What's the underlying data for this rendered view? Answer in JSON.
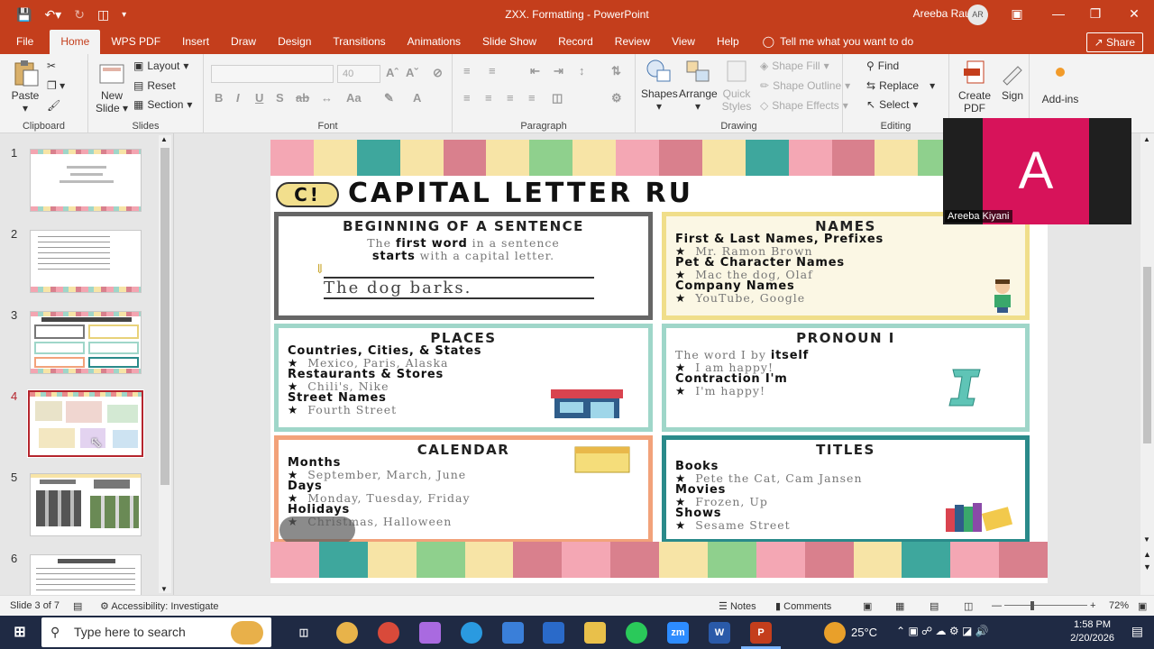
{
  "window": {
    "title": "ZXX. Formatting  -  PowerPoint",
    "user_name": "Areeba Rauf",
    "user_initials": "AR"
  },
  "tabs": [
    "File",
    "Home",
    "WPS PDF",
    "Insert",
    "Draw",
    "Design",
    "Transitions",
    "Animations",
    "Slide Show",
    "Record",
    "Review",
    "View",
    "Help"
  ],
  "tell_me": "Tell me what you want to do",
  "share_label": "Share",
  "ribbon": {
    "clipboard": {
      "label": "Clipboard",
      "paste": "Paste"
    },
    "slides": {
      "label": "Slides",
      "new_slide": "New Slide",
      "layout": "Layout",
      "reset": "Reset",
      "section": "Section"
    },
    "font": {
      "label": "Font",
      "size": "40"
    },
    "paragraph": {
      "label": "Paragraph"
    },
    "drawing": {
      "label": "Drawing",
      "shapes": "Shapes",
      "arrange": "Arrange",
      "quick_styles": "Quick Styles",
      "shape_fill": "Shape Fill",
      "shape_outline": "Shape Outline",
      "shape_effects": "Shape Effects"
    },
    "editing": {
      "label": "Editing",
      "find": "Find",
      "replace": "Replace",
      "select": "Select"
    },
    "pdf": {
      "create_pdf": "Create PDF",
      "sign": "Sign"
    },
    "addins": {
      "label": "Add-ins"
    }
  },
  "slides_panel": [
    "1",
    "2",
    "3",
    "4",
    "5",
    "6"
  ],
  "slide": {
    "heading": "CAPITAL LETTER RU",
    "badge": "C!",
    "cards": {
      "sentence": {
        "title": "BEGINNING OF A SENTENCE",
        "l1a": "The ",
        "l1b": "first word",
        "l1c": " in a sentence",
        "l2a": "starts",
        "l2b": " with a capital letter.",
        "example": "The dog barks."
      },
      "names": {
        "title": "NAMES",
        "h1": "First & Last Names, Prefixes",
        "e1": "Mr. Ramon Brown",
        "h2": "Pet & Character Names",
        "e2": "Mac the dog, Olaf",
        "h3": "Company Names",
        "e3": "YouTube, Google"
      },
      "places": {
        "title": "PLACES",
        "h1": "Countries, Cities, & States",
        "e1": "Mexico, Paris, Alaska",
        "h2": "Restaurants & Stores",
        "e2": "Chili's, Nike",
        "h3": "Street Names",
        "e3": "Fourth Street"
      },
      "pronoun": {
        "title": "PRONOUN I",
        "l1a": "The word I by ",
        "l1b": "itself",
        "e1": "I am happy!",
        "h2": "Contraction I'm",
        "e2": "I'm happy!"
      },
      "calendar": {
        "title": "CALENDAR",
        "h1": "Months",
        "e1": "September, March, June",
        "h2": "Days",
        "e2": "Monday, Tuesday, Friday",
        "h3": "Holidays",
        "e3": "Christmas, Halloween"
      },
      "titles": {
        "title": "TITLES",
        "h1": "Books",
        "e1": "Pete the Cat, Cam Jansen",
        "h2": "Movies",
        "e2": "Frozen, Up",
        "h3": "Shows",
        "e3": "Sesame Street"
      }
    }
  },
  "video": {
    "initial": "A",
    "name": "Areeba Kiyani"
  },
  "status": {
    "slide_count": "Slide 3 of 7",
    "accessibility": "Accessibility: Investigate",
    "notes": "Notes",
    "comments": "Comments",
    "zoom": "72%"
  },
  "taskbar": {
    "search_placeholder": "Type here to search",
    "temperature": "25°C",
    "time": "1:58 PM",
    "date": "2/20/2026"
  },
  "colors": {
    "accent": "#c43e1c",
    "selected_thumb": "#b5252d",
    "taskbar": "#1f2a44",
    "avatar": "#d7135a"
  }
}
